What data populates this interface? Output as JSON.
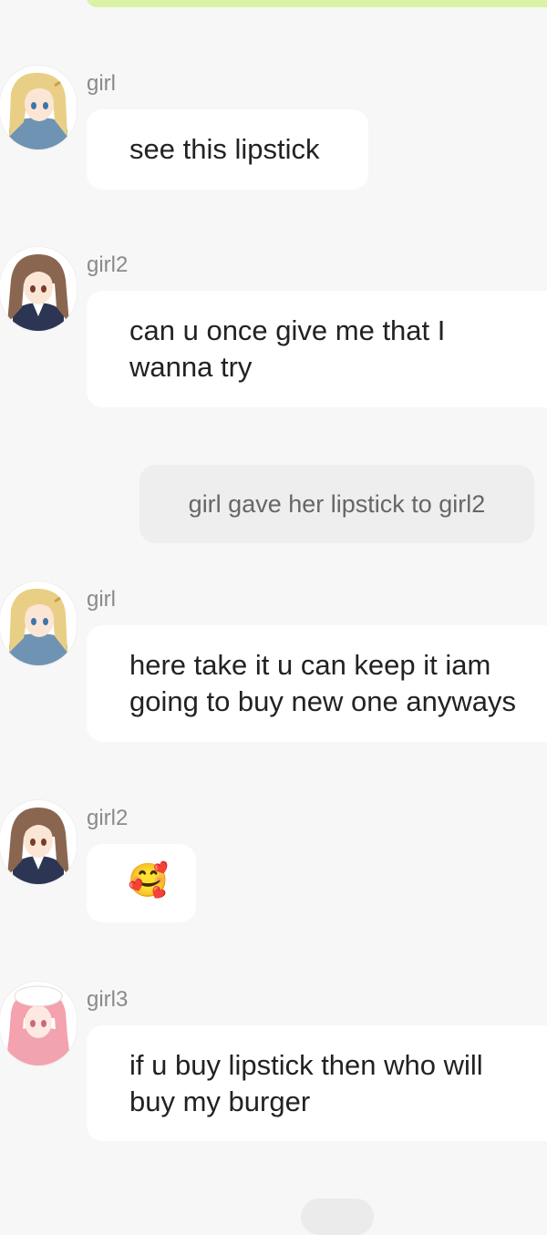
{
  "messages": [
    {
      "sender": "girl",
      "text": "see this lipstick"
    },
    {
      "sender": "girl2",
      "text": "can u once give me that I\nwanna try"
    },
    {
      "narration": "girl gave her lipstick to girl2"
    },
    {
      "sender": "girl",
      "text": "here take it u can keep it iam\ngoing to buy new one anyways"
    },
    {
      "sender": "girl2",
      "text": "🥰"
    },
    {
      "sender": "girl3",
      "text": "if u buy lipstick then who will\nbuy my burger"
    }
  ],
  "colors": {
    "background": "#f7f7f7",
    "bubble": "#ffffff",
    "narration_bubble": "#eeeeee",
    "top_bar": "#d9f2a6"
  },
  "avatars": {
    "girl": "blonde-girl-avatar",
    "girl2": "brown-hair-girl-avatar",
    "girl3": "pink-hair-girl-avatar"
  }
}
